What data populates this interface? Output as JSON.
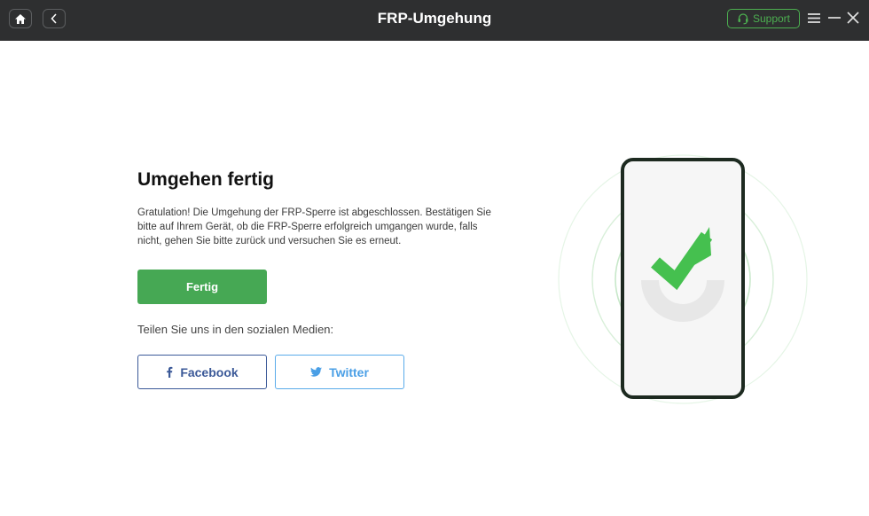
{
  "titlebar": {
    "title": "FRP-Umgehung",
    "support_label": "Support"
  },
  "main": {
    "heading": "Umgehen fertig",
    "description": "Gratulation! Die Umgehung der FRP-Sperre ist abgeschlossen. Bestätigen Sie bitte auf Ihrem Gerät, ob die FRP-Sperre erfolgreich umgangen wurde, falls nicht, gehen Sie bitte zurück und versuchen Sie es erneut.",
    "done_label": "Fertig",
    "share_label": "Teilen Sie uns in den sozialen Medien:",
    "facebook_label": "Facebook",
    "twitter_label": "Twitter"
  },
  "icons": {
    "home": "home-icon",
    "back": "chevron-left-icon",
    "support": "headset-icon",
    "menu": "menu-icon",
    "minimize": "minimize-icon",
    "close": "close-icon",
    "facebook": "facebook-icon",
    "twitter": "twitter-icon",
    "illustration": "phone-checkmark-icon"
  },
  "colors": {
    "titlebar_bg": "#2e2f30",
    "accent_green": "#46a854",
    "support_green": "#4caf50",
    "facebook_blue": "#3b5998",
    "twitter_blue": "#4a9fe6",
    "phone_frame": "#1d2a20"
  }
}
